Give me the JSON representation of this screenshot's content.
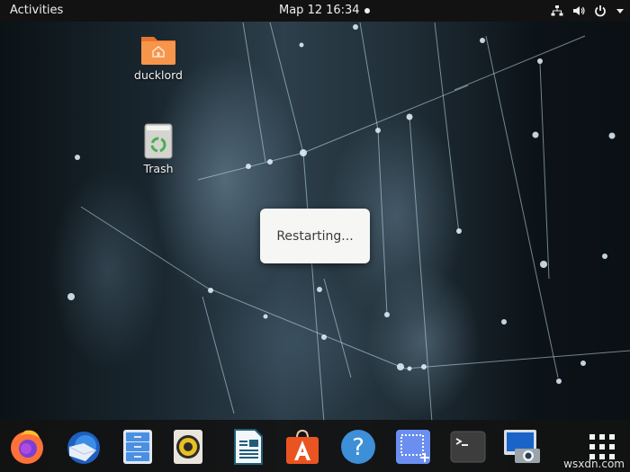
{
  "topbar": {
    "activities_label": "Activities",
    "date": "Map 12",
    "time": "16:34",
    "tray_icons": [
      "network-icon",
      "volume-icon",
      "power-icon",
      "menu-caret-icon"
    ]
  },
  "desktop": {
    "icons": [
      {
        "label": "ducklord",
        "icon": "home-folder-icon",
        "color": "#f5893f"
      },
      {
        "label": "Trash",
        "icon": "trash-icon",
        "color": "#d9d9d6"
      }
    ]
  },
  "dialog": {
    "message": "Restarting..."
  },
  "dock": {
    "items": [
      {
        "name": "Firefox",
        "icon": "firefox-icon"
      },
      {
        "name": "Thunderbird",
        "icon": "thunderbird-icon"
      },
      {
        "name": "Files",
        "icon": "files-icon"
      },
      {
        "name": "Rhythmbox",
        "icon": "rhythmbox-icon"
      },
      {
        "name": "LibreOffice Writer",
        "icon": "writer-icon"
      },
      {
        "name": "Ubuntu Software",
        "icon": "software-icon"
      },
      {
        "name": "Help",
        "icon": "help-icon"
      },
      {
        "name": "Screenshot",
        "icon": "screenshot-icon"
      },
      {
        "name": "Terminal",
        "icon": "terminal-icon"
      },
      {
        "name": "Remote Desktop Viewer",
        "icon": "remote-desktop-icon"
      },
      {
        "name": "Show Applications",
        "icon": "app-grid-icon"
      }
    ]
  },
  "watermark": "wsxdn.com",
  "colors": {
    "topbar_bg": "#121212",
    "dialog_bg": "#f6f6f5",
    "accent_orange": "#e95420"
  }
}
